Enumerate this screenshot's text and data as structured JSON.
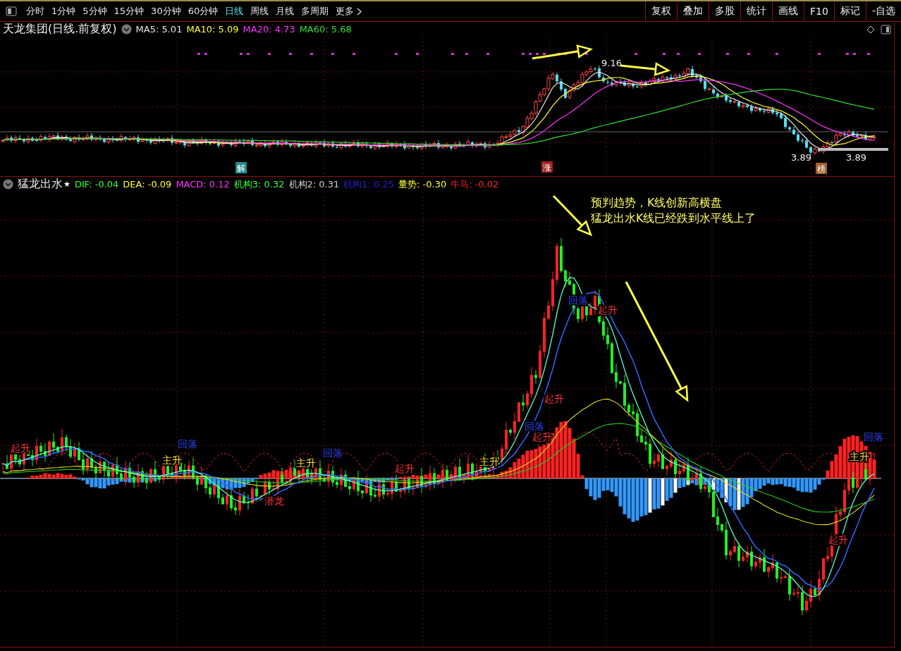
{
  "toolbar": {
    "periods": [
      {
        "label": "分时",
        "selected": false
      },
      {
        "label": "1分钟",
        "selected": false
      },
      {
        "label": "5分钟",
        "selected": false
      },
      {
        "label": "15分钟",
        "selected": false
      },
      {
        "label": "30分钟",
        "selected": false
      },
      {
        "label": "60分钟",
        "selected": false
      },
      {
        "label": "日线",
        "selected": true
      },
      {
        "label": "周线",
        "selected": false
      },
      {
        "label": "月线",
        "selected": false
      },
      {
        "label": "多周期",
        "selected": false
      },
      {
        "label": "更多",
        "selected": false
      }
    ],
    "buttons": [
      "复权",
      "叠加",
      "多股",
      "统计",
      "画线",
      "F10",
      "标记",
      "-自选"
    ]
  },
  "main_chart": {
    "title": "天龙集团(日线.前复权)",
    "indicators": [
      {
        "label": "MA5: 5.01",
        "color": "#e8e8e8"
      },
      {
        "label": "MA10: 5.09",
        "color": "#ffff33"
      },
      {
        "label": "MA20: 4.73",
        "color": "#ff33ff"
      },
      {
        "label": "MA60: 5.68",
        "color": "#33dd33"
      }
    ],
    "high_label": "9.16",
    "low_labels": [
      "3.89",
      "3.89"
    ],
    "markers": [
      {
        "text": "解",
        "color": "#1f8a8a"
      },
      {
        "text": "涨",
        "color": "#a02020"
      },
      {
        "text": "榜",
        "color": "#a0602a"
      }
    ]
  },
  "indicator_chart": {
    "title": "猛龙出水",
    "star": "★",
    "values": [
      {
        "label": "DIF: -0.04",
        "color": "#33ff33"
      },
      {
        "label": "DEA: -0.09",
        "color": "#ffff33"
      },
      {
        "label": "MACD: 0.12",
        "color": "#ff33ff"
      },
      {
        "label": "机构3: 0.32",
        "color": "#33ff33"
      },
      {
        "label": "机构2: 0.31",
        "color": "#d0d0d0"
      },
      {
        "label": "机构1: 0.25",
        "color": "#2222cc"
      },
      {
        "label": "量势: -0.30",
        "color": "#ffff33"
      },
      {
        "label": "牛马: -0.02",
        "color": "#ff2222"
      }
    ],
    "signals": [
      {
        "text": "起升",
        "kind": "rise"
      },
      {
        "text": "主升",
        "kind": "main"
      },
      {
        "text": "回落",
        "kind": "fall"
      },
      {
        "text": "主升",
        "kind": "main"
      },
      {
        "text": "回落",
        "kind": "fall"
      },
      {
        "text": "起升",
        "kind": "rise"
      },
      {
        "text": "主升",
        "kind": "main"
      },
      {
        "text": "潜龙",
        "kind": "rise"
      },
      {
        "text": "回落",
        "kind": "fall"
      },
      {
        "text": "起升",
        "kind": "rise"
      },
      {
        "text": "起升",
        "kind": "rise"
      },
      {
        "text": "回落",
        "kind": "fall"
      },
      {
        "text": "起升",
        "kind": "rise"
      },
      {
        "text": "主升",
        "kind": "main"
      },
      {
        "text": "回落",
        "kind": "fall"
      },
      {
        "text": "起升",
        "kind": "rise"
      }
    ],
    "note": [
      "预判趋势，K线创新高横盘",
      "猛龙出水K线已经跌到水平线上了"
    ]
  }
}
